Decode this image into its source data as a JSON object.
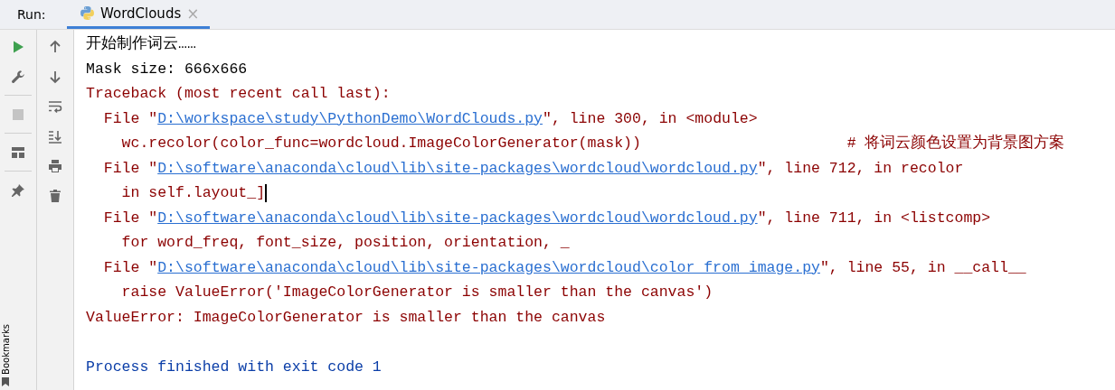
{
  "run_bar": {
    "label": "Run:",
    "tabs": [
      {
        "title": "WordClouds",
        "selected": true,
        "close": "×"
      }
    ]
  },
  "side_label": "Bookmarks",
  "console": {
    "lines": [
      {
        "kind": "stdout",
        "parts": [
          {
            "text": "开始制作词云……",
            "kind": "text"
          }
        ]
      },
      {
        "kind": "stdout",
        "parts": [
          {
            "text": "Mask size: 666x666",
            "kind": "text"
          }
        ]
      },
      {
        "kind": "stderr",
        "parts": [
          {
            "text": "Traceback (most recent call last):",
            "kind": "text"
          }
        ]
      },
      {
        "kind": "stderr",
        "parts": [
          {
            "text": "  File \"",
            "kind": "text"
          },
          {
            "text": "D:\\workspace\\study\\PythonDemo\\WordClouds.py",
            "kind": "link"
          },
          {
            "text": "\", line 300, in <module>",
            "kind": "text"
          }
        ]
      },
      {
        "kind": "stderr",
        "parts": [
          {
            "text": "    wc.recolor(color_func=wordcloud.ImageColorGenerator(mask))                       # 将词云颜色设置为背景图方案",
            "kind": "text"
          }
        ]
      },
      {
        "kind": "stderr",
        "parts": [
          {
            "text": "  File \"",
            "kind": "text"
          },
          {
            "text": "D:\\software\\anaconda\\cloud\\lib\\site-packages\\wordcloud\\wordcloud.py",
            "kind": "link"
          },
          {
            "text": "\", line 712, in recolor",
            "kind": "text"
          }
        ]
      },
      {
        "kind": "stderr",
        "cursor": true,
        "parts": [
          {
            "text": "    in self.layout_]",
            "kind": "text"
          }
        ]
      },
      {
        "kind": "stderr",
        "parts": [
          {
            "text": "  File \"",
            "kind": "text"
          },
          {
            "text": "D:\\software\\anaconda\\cloud\\lib\\site-packages\\wordcloud\\wordcloud.py",
            "kind": "link"
          },
          {
            "text": "\", line 711, in <listcomp>",
            "kind": "text"
          }
        ]
      },
      {
        "kind": "stderr",
        "parts": [
          {
            "text": "    for word_freq, font_size, position, orientation, _",
            "kind": "text"
          }
        ]
      },
      {
        "kind": "stderr",
        "parts": [
          {
            "text": "  File \"",
            "kind": "text"
          },
          {
            "text": "D:\\software\\anaconda\\cloud\\lib\\site-packages\\wordcloud\\color_from_image.py",
            "kind": "link"
          },
          {
            "text": "\", line 55, in __call__",
            "kind": "text"
          }
        ]
      },
      {
        "kind": "stderr",
        "parts": [
          {
            "text": "    raise ValueError('ImageColorGenerator is smaller than the canvas')",
            "kind": "text"
          }
        ]
      },
      {
        "kind": "stderr",
        "parts": [
          {
            "text": "ValueError: ImageColorGenerator is smaller than the canvas",
            "kind": "text"
          }
        ]
      },
      {
        "kind": "blank"
      },
      {
        "kind": "system",
        "parts": [
          {
            "text": "Process finished with exit code 1",
            "kind": "text"
          }
        ]
      }
    ]
  }
}
